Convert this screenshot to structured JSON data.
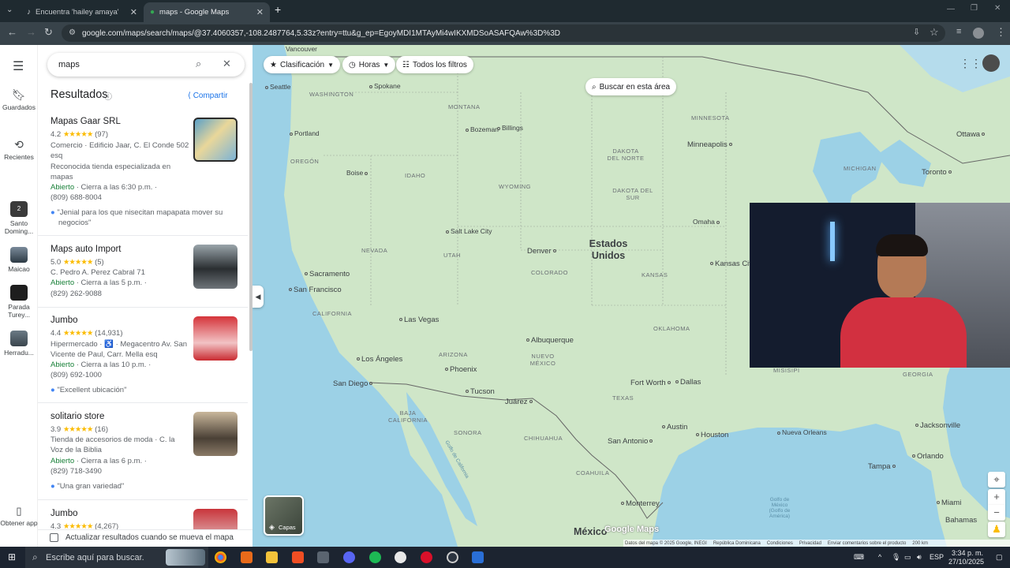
{
  "browser": {
    "tabs": [
      {
        "title": "Encuentra 'hailey amaya' en Tik"
      },
      {
        "title": "maps - Google Maps"
      }
    ],
    "url": "google.com/maps/search/maps/@37.4060357,-108.2487764,5.33z?entry=ttu&g_ep=EgoyMDI1MTAyMi4wIKXMDSoASAFQAw%3D%3D"
  },
  "rail": {
    "saved": "Guardados",
    "recent": "Recientes",
    "places": [
      {
        "label": "Santo Doming...",
        "badge": "2"
      },
      {
        "label": "Maicao"
      },
      {
        "label": "Parada Turey..."
      },
      {
        "label": "Herradu..."
      }
    ],
    "get_app": "Obtener app"
  },
  "panel": {
    "search_value": "maps",
    "results_title": "Resultados",
    "share": "Compartir",
    "update_checkbox": "Actualizar resultados cuando se mueva el mapa",
    "results": [
      {
        "name": "Mapas Gaar SRL",
        "rating": "4.2",
        "stars": "★★★★★",
        "count": "(97)",
        "line1": "Comercio · Edificio Jaar, C. El Conde 502",
        "line2": "esq",
        "line3": "Reconocida tienda especializada en",
        "line4": "mapas",
        "hours_status": "Abierto",
        "hours": " · Cierra a las 6:30 p.m. ·",
        "phone": "(809) 688-8004",
        "review": "\"Jenial para los que nisecitan mapapata mover su",
        "review2": "negocios\""
      },
      {
        "name": "Maps auto Import",
        "rating": "5.0",
        "stars": "★★★★★",
        "count": "(5)",
        "line1": "C. Pedro A. Perez Cabral 71",
        "hours_status": "Abierto",
        "hours": " · Cierra a las 5 p.m. ·",
        "phone": "(829) 262-9088"
      },
      {
        "name": "Jumbo",
        "rating": "4.4",
        "stars": "★★★★★",
        "count": "(14,931)",
        "line1": "Hipermercado · ♿ · Megacentro Av. San",
        "line2": "Vicente de Paul, Carr. Mella esq",
        "hours_status": "Abierto",
        "hours": " · Cierra a las 10 p.m. ·",
        "phone": "(809) 692-1000",
        "review": "\"Excellent ubicación\""
      },
      {
        "name": "solitario store",
        "rating": "3.9",
        "stars": "★★★★★",
        "count": "(16)",
        "line1": "Tienda de accesorios de moda · C. la",
        "line2": "Voz de la Biblia",
        "hours_status": "Abierto",
        "hours": " · Cierra a las 6 p.m. ·",
        "phone": "(829) 718-3490",
        "review": "\"Una gran variedad\""
      },
      {
        "name": "Jumbo",
        "rating": "4.3",
        "stars": "★★★★★",
        "count": "(4,267)"
      }
    ]
  },
  "map": {
    "chips": [
      "Clasificación",
      "Horas",
      "Todos los filtros"
    ],
    "search_area": "Buscar en esta área",
    "layers": "Capas",
    "country_us": "Estados Unidos",
    "country_mx": "México",
    "logo": "Google Maps",
    "scale": "200 km",
    "footer": [
      "Datos del mapa © 2025 Google, INEGI",
      "República Dominicana",
      "Condiciones",
      "Privacidad",
      "Enviar comentarios sobre el producto"
    ],
    "cities": [
      "Vancouver",
      "Seattle",
      "Spokane",
      "Portland",
      "Bozeman",
      "Billings",
      "Boise",
      "Minneapolis",
      "Ottawa",
      "Toronto",
      "Omaha",
      "Salt Lake City",
      "Denver",
      "Sacramento",
      "San Francisco",
      "Kansas Cit",
      "Las Vegas",
      "Albuquerque",
      "Los Ángeles",
      "Phoenix",
      "San Diego",
      "Tucson",
      "Juárez",
      "Fort Worth",
      "Dallas",
      "Austin",
      "Houston",
      "San Antonio",
      "Nueva Orleans",
      "Jacksonville",
      "Orlando",
      "Tampa",
      "Miami",
      "Monterrey",
      "Bahamas",
      "Golfo de México (Golfo de América)",
      "Golfo de California"
    ],
    "states": [
      "WASHINGTON",
      "MONTANA",
      "DAKOTA DEL NORTE",
      "MINNESOTA",
      "OREGÓN",
      "IDAHO",
      "WYOMING",
      "DAKOTA DEL SUR",
      "MICHIGAN",
      "NEVADA",
      "UTAH",
      "COLORADO",
      "KANSAS",
      "CALIFORNIA",
      "ARIZONA",
      "NUEVO MÉXICO",
      "OKLAHOMA",
      "TEXAS",
      "GEORGIA",
      "BAJA CALIFORNIA",
      "CHIHUAHUA",
      "SONORA",
      "COAHUILA",
      "MISISIPI"
    ]
  },
  "taskbar": {
    "search_placeholder": "Escribe aquí para buscar.",
    "lang": "ESP",
    "time": "3:34 p. m.",
    "date": "27/10/2025"
  },
  "colors": {
    "accent": "#1a73e8",
    "open": "#188038",
    "map_land": "#cfe6c8",
    "water": "#9cd1e6"
  }
}
